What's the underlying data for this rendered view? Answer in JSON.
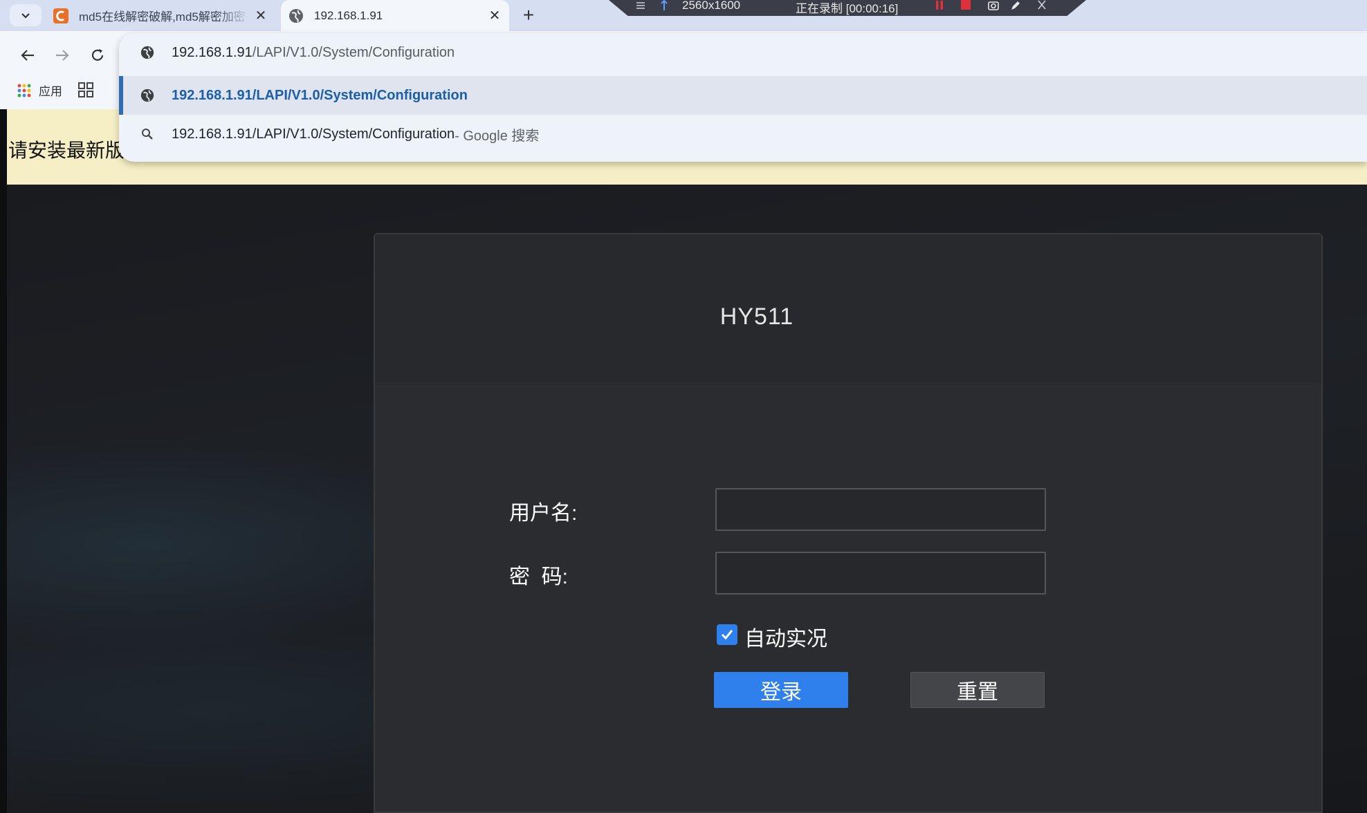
{
  "browser": {
    "tabs": [
      {
        "title": "md5在线解密破解,md5解密加密",
        "active": false
      },
      {
        "title": "192.168.1.91",
        "active": true
      }
    ],
    "address": {
      "host": "192.168.1.91",
      "path": "/LAPI/V1.0/System/Configuration"
    },
    "suggestions": [
      {
        "text": "192.168.1.91/LAPI/V1.0/System/Configuration",
        "icon": "globe-icon",
        "selected": true
      },
      {
        "text": "192.168.1.91/LAPI/V1.0/System/Configuration",
        "suffix": " - Google 搜索",
        "icon": "search-icon"
      }
    ],
    "bookmarks": {
      "apps_label": "应用"
    }
  },
  "recorder": {
    "resolution": "2560x1600",
    "status": "正在录制 [00:00:16]"
  },
  "page": {
    "warning": "请安装最新版"
  },
  "login": {
    "title": "HY511",
    "username_label": "用户名:",
    "password_label": "密  码:",
    "username_value": "",
    "password_value": "",
    "auto_live_label": "自动实况",
    "auto_live_checked": true,
    "login_button": "登录",
    "reset_button": "重置"
  },
  "colors": {
    "accent": "#2f80ed",
    "selected_suggestion": "#1a5fa8",
    "warning_bg": "#f6efc5"
  }
}
